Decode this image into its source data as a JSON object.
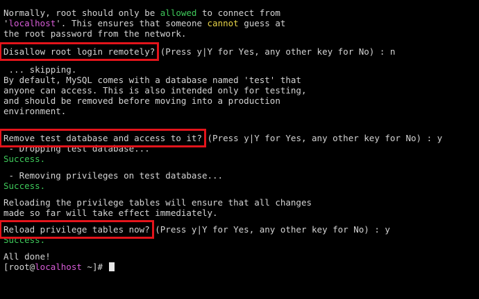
{
  "intro": {
    "line1_a": "Normally, root should only be ",
    "line1_allowed": "allowed",
    "line1_b": " to connect from",
    "line2_q1": "'",
    "line2_host": "localhost",
    "line2_q2": "'",
    "line2_a": ". This ensures that someone ",
    "line2_cannot": "cannot",
    "line2_b": " guess at",
    "line3": "the root password from the network."
  },
  "prompt1": {
    "question": "Disallow root login remotely?",
    "options": " (Press y|Y for Yes, any other key for No) : ",
    "answer": "n"
  },
  "skip": {
    "line1": " ... skipping.",
    "line2": "By default, MySQL comes with a database named 'test' that",
    "line3": "anyone can access. This is also intended only for testing,",
    "line4": "and should be removed before moving into a production",
    "line5": "environment."
  },
  "prompt2": {
    "question": "Remove test database and access to it?",
    "options": " (Press y|Y for Yes, any other key for No) : ",
    "answer": "y"
  },
  "drop": {
    "line1": " - Dropping test database...",
    "success1": "Success.",
    "line2": " - Removing privileges on test database...",
    "success2": "Success."
  },
  "reload_info": {
    "line1": "Reloading the privilege tables will ensure that all changes",
    "line2": "made so far will take effect immediately."
  },
  "prompt3": {
    "question": "Reload privilege tables now?",
    "options": " (Press y|Y for Yes, any other key for No) : ",
    "answer": "y"
  },
  "result": {
    "success": "Success.",
    "done": "All done!"
  },
  "shell_prompt": {
    "open": "[root@",
    "host": "localhost",
    "close": " ~]# "
  },
  "colors": {
    "background": "#000000",
    "text": "#d4d4d4",
    "success_green": "#3ec95a",
    "host_magenta": "#d85cd8",
    "cannot_yellow": "#e6d247",
    "highlight_red": "#e3141b"
  }
}
